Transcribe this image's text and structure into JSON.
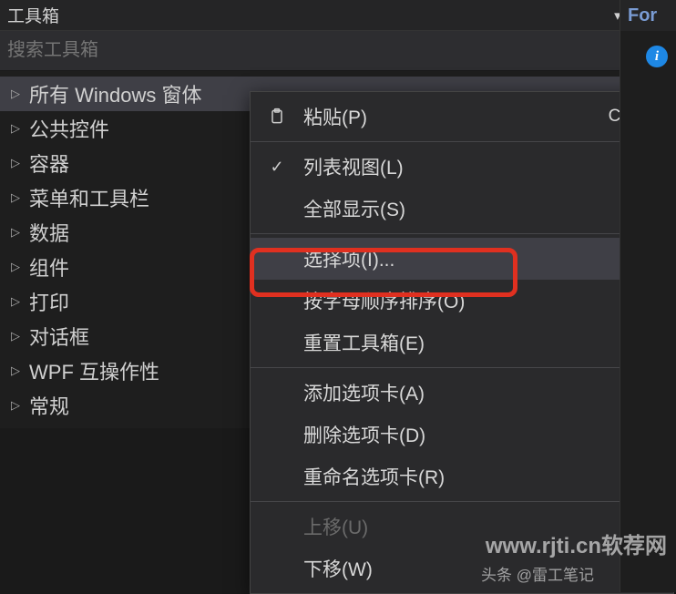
{
  "panel": {
    "title": "工具箱"
  },
  "search": {
    "placeholder": "搜索工具箱"
  },
  "tree": {
    "items": [
      {
        "label": "所有 Windows 窗体",
        "selected": true
      },
      {
        "label": "公共控件",
        "selected": false
      },
      {
        "label": "容器",
        "selected": false
      },
      {
        "label": "菜单和工具栏",
        "selected": false
      },
      {
        "label": "数据",
        "selected": false
      },
      {
        "label": "组件",
        "selected": false
      },
      {
        "label": "打印",
        "selected": false
      },
      {
        "label": "对话框",
        "selected": false
      },
      {
        "label": "WPF 互操作性",
        "selected": false
      },
      {
        "label": "常规",
        "selected": false
      }
    ]
  },
  "contextMenu": {
    "items": [
      {
        "label": "粘贴(P)",
        "shortcut": "Ctrl+V",
        "icon": "paste"
      },
      {
        "separator": true
      },
      {
        "label": "列表视图(L)",
        "icon": "check"
      },
      {
        "label": "全部显示(S)"
      },
      {
        "separator": true
      },
      {
        "label": "选择项(I)...",
        "highlighted": true
      },
      {
        "label": "按字母顺序排序(O)"
      },
      {
        "label": "重置工具箱(E)"
      },
      {
        "separator": true
      },
      {
        "label": "添加选项卡(A)"
      },
      {
        "label": "删除选项卡(D)"
      },
      {
        "label": "重命名选项卡(R)"
      },
      {
        "separator": true
      },
      {
        "label": "上移(U)",
        "disabled": true
      },
      {
        "label": "下移(W)"
      }
    ]
  },
  "rightPanel": {
    "tabLabel": "For"
  },
  "watermark": {
    "line1": "www.rjti.cn软荐网",
    "line2": "头条 @雷工笔记"
  }
}
